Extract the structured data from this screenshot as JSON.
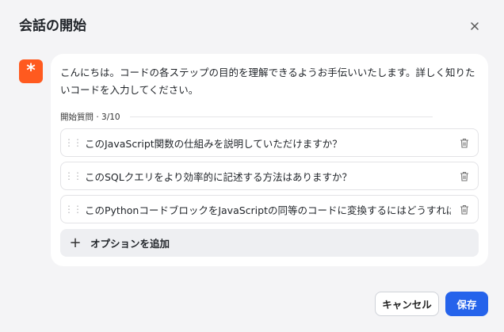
{
  "dialog": {
    "title": "会話の開始",
    "close_label": "×"
  },
  "assistant": {
    "icon": "asterisk-icon",
    "message": "こんにちは。コードの各ステップの目的を理解できるようお手伝いいたします。詳しく知りたいコードを入力してください。"
  },
  "starters": {
    "label": "開始質問 · 3/10",
    "options": [
      {
        "text": "このJavaScript関数の仕組みを説明していただけますか？"
      },
      {
        "text": "このSQLクエリをより効率的に記述する方法はありますか？"
      },
      {
        "text": "このPythonコードブロックをJavaScriptの同等のコードに変換するにはどうすればよいです"
      }
    ],
    "add_label": "オプションを追加"
  },
  "footer": {
    "cancel_label": "キャンセル",
    "save_label": "保存"
  },
  "colors": {
    "accent": "#2563eb",
    "avatar": "#ff5a1f"
  }
}
